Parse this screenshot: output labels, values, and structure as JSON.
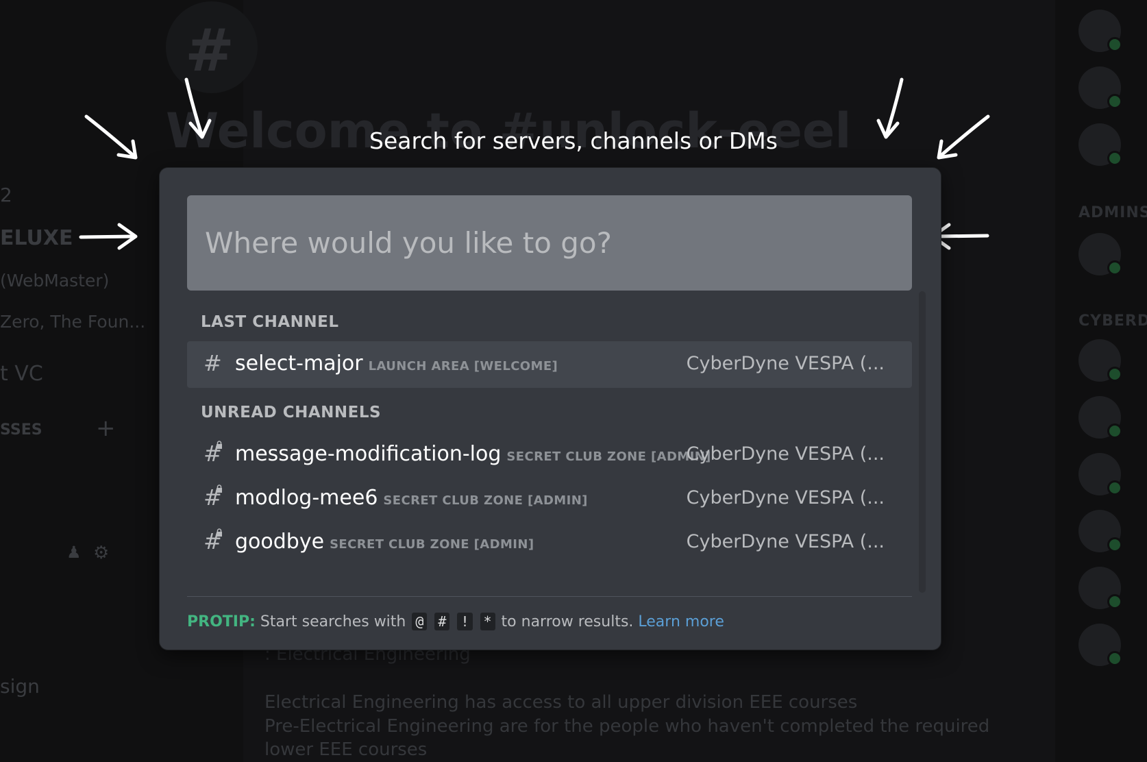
{
  "background": {
    "welcome_text": "Welcome to #unlock-eeel",
    "left_items": [
      "2",
      "ELUXE",
      "(WebMaster)",
      "Zero, The Foun...",
      "t VC",
      "SSES",
      "sign"
    ],
    "side_headers": [
      "ADMINS",
      "CYBERD"
    ],
    "bottom_lines": [
      ": Electrical Engineering",
      "Electrical Engineering has access to all upper division EEE courses",
      "Pre-Electrical Engineering are for the people who haven't completed the required",
      "lower EEE courses"
    ]
  },
  "title": "Search for servers, channels or DMs",
  "search": {
    "placeholder": "Where would you like to go?",
    "value": ""
  },
  "sections": {
    "last_channel": "LAST CHANNEL",
    "unread_channels": "UNREAD CHANNELS"
  },
  "last_channel": {
    "name": "select-major",
    "category": "LAUNCH AREA [WELCOME]",
    "server": "CyberDyne VESPA (...",
    "icon": "hash-icon"
  },
  "unread": [
    {
      "name": "message-modification-log",
      "category": "SECRET CLUB ZONE [ADMIN]",
      "server": "CyberDyne VESPA (...",
      "icon": "locked-hash-icon"
    },
    {
      "name": "modlog-mee6",
      "category": "SECRET CLUB ZONE [ADMIN]",
      "server": "CyberDyne VESPA (...",
      "icon": "locked-hash-icon"
    },
    {
      "name": "goodbye",
      "category": "SECRET CLUB ZONE [ADMIN]",
      "server": "CyberDyne VESPA (...",
      "icon": "locked-hash-icon"
    }
  ],
  "protip": {
    "label": "PROTIP:",
    "text_before": " Start searches with ",
    "codes": [
      "@",
      "#",
      "!",
      "*"
    ],
    "text_after": " to narrow results. ",
    "link": "Learn more"
  },
  "colors": {
    "modal_bg": "#36393f",
    "search_bg": "#72767d",
    "selected_row": "#42464d",
    "protip_green": "#43b581",
    "link_blue": "#5b9fd6"
  }
}
